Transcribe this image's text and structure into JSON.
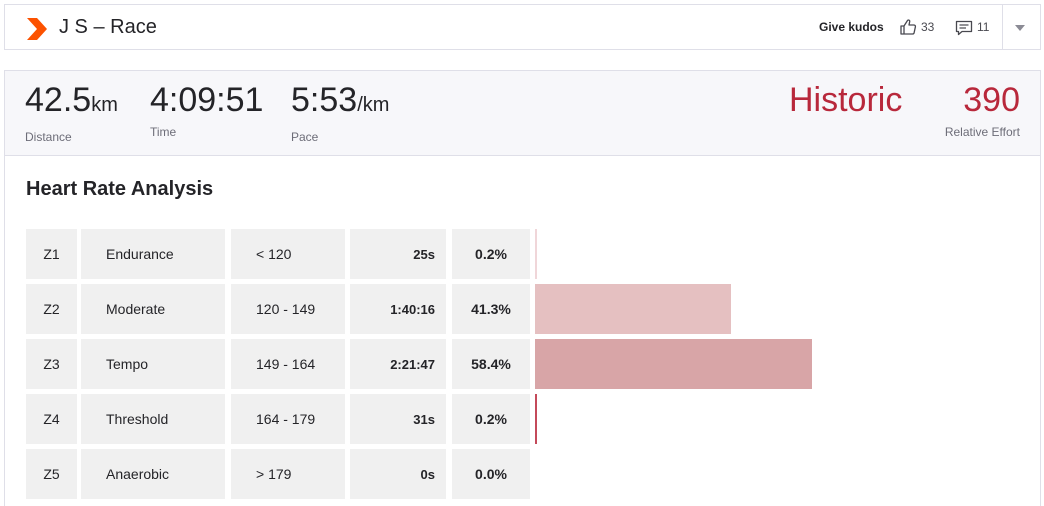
{
  "header": {
    "title": "J S – Race",
    "give_kudos_label": "Give kudos",
    "kudos_count": "33",
    "comment_count": "11"
  },
  "stats": {
    "distance": {
      "value": "42.5",
      "unit": "km",
      "label": "Distance"
    },
    "time": {
      "value": "4:09:51",
      "label": "Time"
    },
    "pace": {
      "value": "5:53",
      "unit": "/km",
      "label": "Pace"
    },
    "effort_level": "Historic",
    "relative_effort": {
      "value": "390",
      "label": "Relative Effort"
    }
  },
  "heart_rate": {
    "title": "Heart Rate Analysis",
    "zones": [
      {
        "zone": "Z1",
        "name": "Endurance",
        "range": "< 120",
        "time": "25s",
        "percent": "0.2%",
        "fraction": 0.002,
        "color": "#f0d6d9"
      },
      {
        "zone": "Z2",
        "name": "Moderate",
        "range": "120 - 149",
        "time": "1:40:16",
        "percent": "41.3%",
        "fraction": 0.413,
        "color": "#e5c0c1"
      },
      {
        "zone": "Z3",
        "name": "Tempo",
        "range": "149 - 164",
        "time": "2:21:47",
        "percent": "58.4%",
        "fraction": 0.584,
        "color": "#d8a5a7"
      },
      {
        "zone": "Z4",
        "name": "Threshold",
        "range": "164 - 179",
        "time": "31s",
        "percent": "0.2%",
        "fraction": 0.002,
        "color": "#c44a5a"
      },
      {
        "zone": "Z5",
        "name": "Anaerobic",
        "range": "> 179",
        "time": "0s",
        "percent": "0.0%",
        "fraction": 0.0,
        "color": "#b8283b"
      }
    ]
  },
  "colors": {
    "brand": "#fc5200",
    "accent_red": "#b8283b"
  },
  "icons": {
    "logo": "brand-chevron-icon",
    "kudos": "thumbs-up-icon",
    "comments": "comment-icon",
    "menu": "chevron-down-icon"
  }
}
